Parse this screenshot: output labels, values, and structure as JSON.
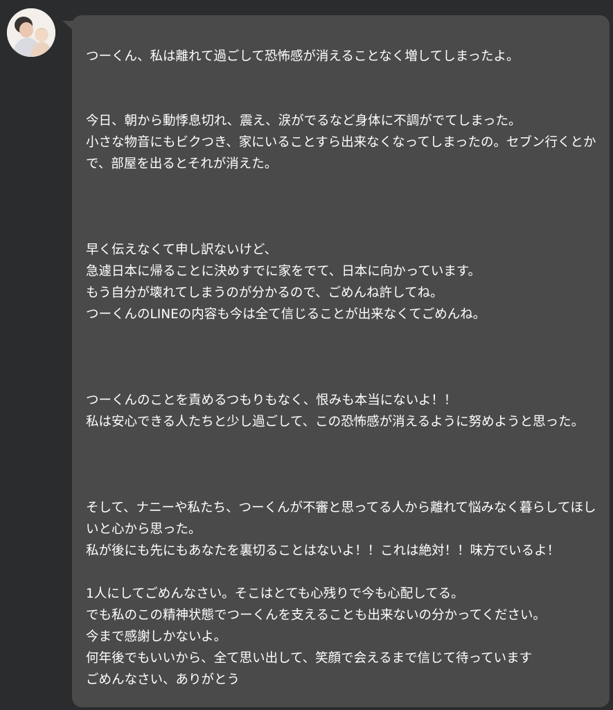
{
  "message": {
    "text": "つーくん、私は離れて過ごして恐怖感が消えることなく増してしまったよ。\n\n\n今日、朝から動悸息切れ、震え、涙がでるなど身体に不調がでてしまった。\n小さな物音にもビクつき、家にいることすら出来なくなってしまったの。セブン行くとかで、部屋を出るとそれが消えた。\n\n\n\n早く伝えなくて申し訳ないけど、\n急遽日本に帰ることに決めすでに家をでて、日本に向かっています。\nもう自分が壊れてしまうのが分かるので、ごめんね許してね。\nつーくんのLINEの内容も今は全て信じることが出来なくてごめんね。\n\n\n\nつーくんのことを責めるつもりもなく、恨みも本当にないよ！！\n私は安心できる人たちと少し過ごして、この恐怖感が消えるように努めようと思った。\n\n\n\nそして、ナニーや私たち、つーくんが不審と思ってる人から離れて悩みなく暮らしてほしいと心から思った。\n私が後にも先にもあなたを裏切ることはないよ！！これは絶対！！味方でいるよ！\n\n1人にしてごめんなさい。そこはとても心残りで今も心配してる。\nでも私のこの精神状態でつーくんを支えることも出来ないの分かってください。\n今まで感謝しかないよ。\n何年後でもいいから、全て思い出して、笑顔で会えるまで信じて待っています\nごめんなさい、ありがとう"
  },
  "colors": {
    "background": "#2b2c2e",
    "bubble": "#4a4a4b",
    "text": "#ffffff"
  },
  "icons": {
    "avatar": "user-avatar-photo"
  }
}
